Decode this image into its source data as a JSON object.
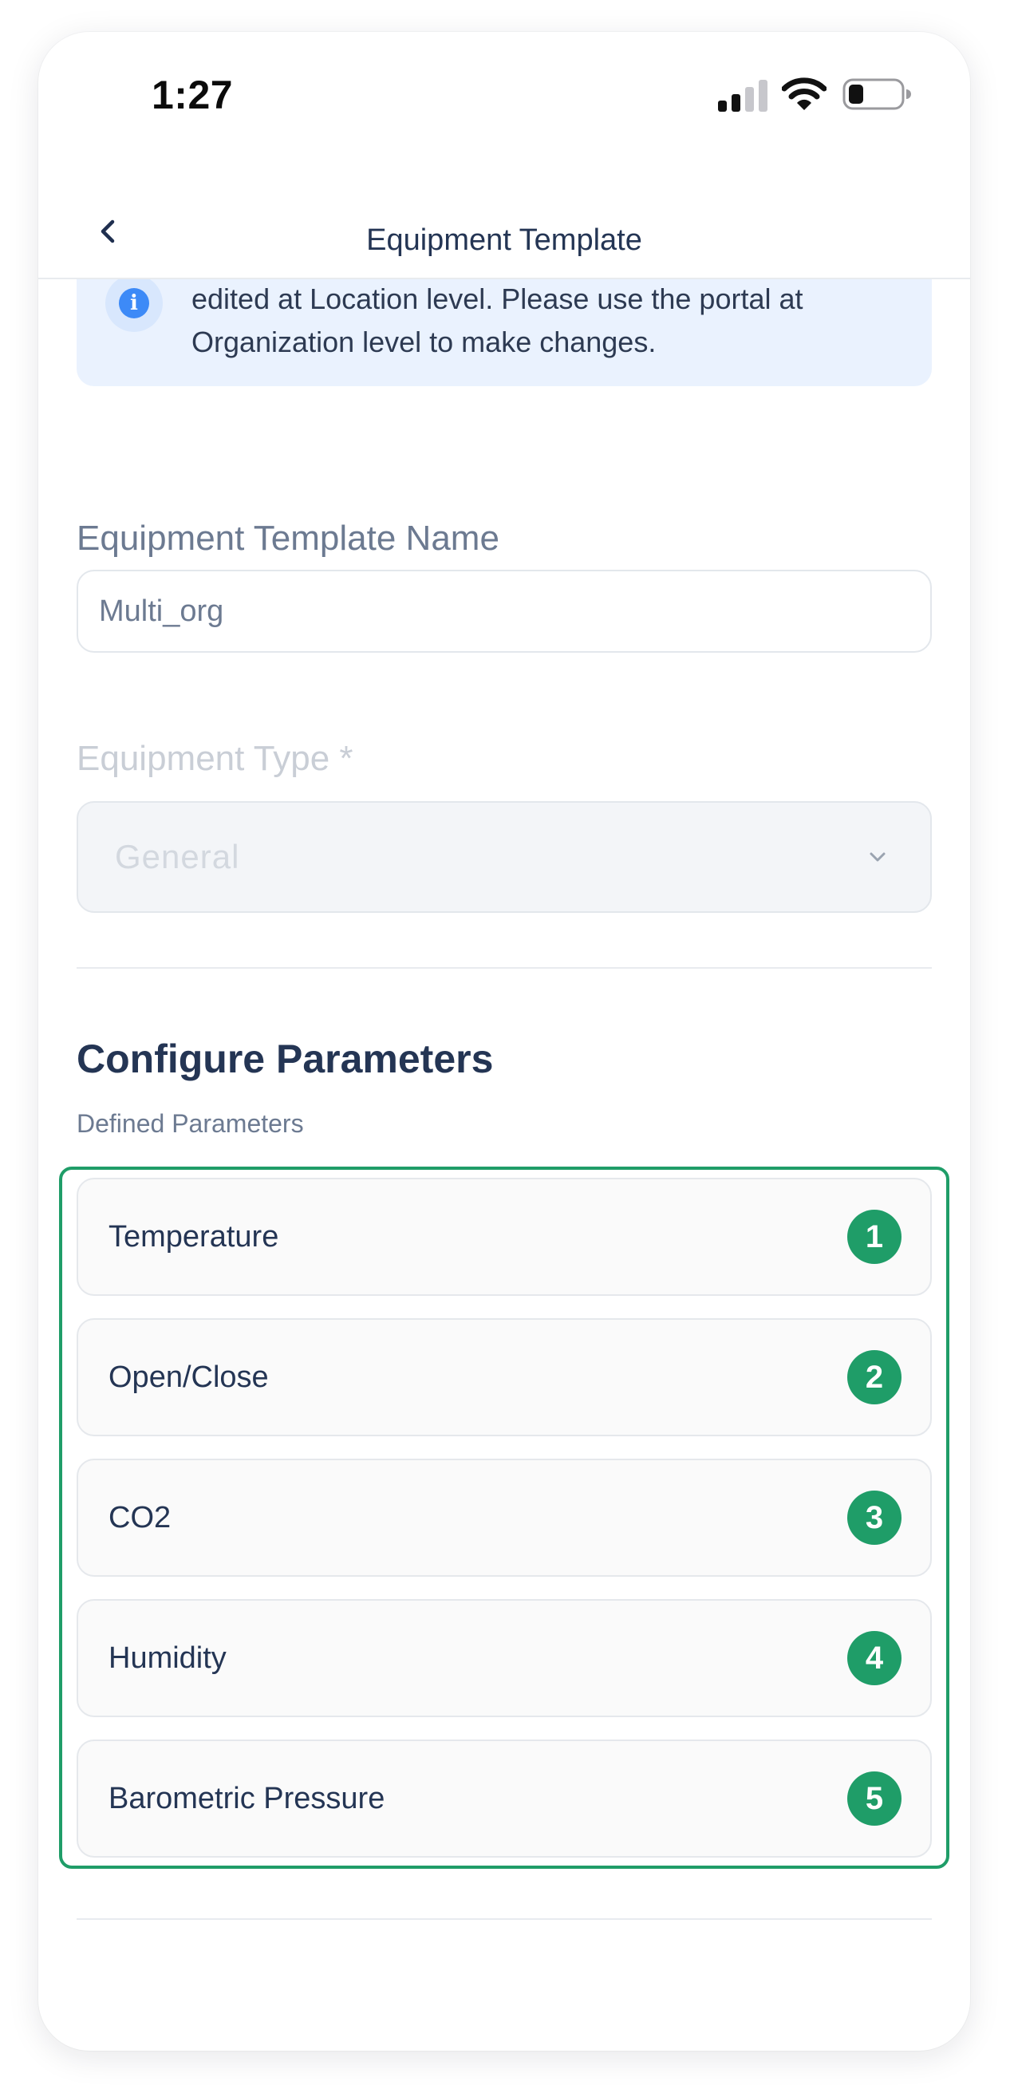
{
  "status_bar": {
    "time": "1:27"
  },
  "nav": {
    "title": "Equipment Template",
    "back_icon": "chevron-left-icon"
  },
  "info_banner": {
    "icon": "info-icon",
    "icon_glyph": "i",
    "line1": "edited at Location level. Please use the portal at",
    "line2": "Organization level to make changes."
  },
  "template_name": {
    "label": "Equipment Template Name",
    "value": "Multi_org"
  },
  "equipment_type": {
    "label": "Equipment Type *",
    "selected": "General",
    "disabled": true
  },
  "parameters": {
    "title": "Configure Parameters",
    "subtitle": "Defined Parameters",
    "items": [
      {
        "label": "Temperature",
        "badge": "1"
      },
      {
        "label": "Open/Close",
        "badge": "2"
      },
      {
        "label": "CO2",
        "badge": "3"
      },
      {
        "label": "Humidity",
        "badge": "4"
      },
      {
        "label": "Barometric Pressure",
        "badge": "5"
      }
    ]
  },
  "colors": {
    "accent_green": "#1f9d68",
    "info_blue": "#3d8af7",
    "banner_bg": "#eaf2fe",
    "title_text": "#243554"
  }
}
